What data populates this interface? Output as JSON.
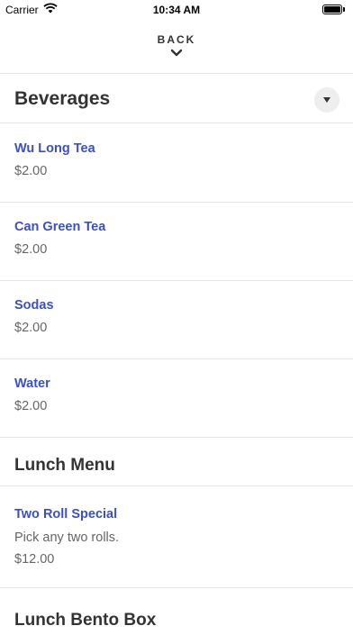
{
  "status_bar": {
    "carrier": "Carrier",
    "time": "10:34 AM",
    "battery_level": 1.0
  },
  "nav": {
    "back_label": "BACK",
    "back_icon": "chevron-down-icon"
  },
  "beverages": {
    "title": "Beverages",
    "toggle_icon": "caret-down-icon",
    "items": [
      {
        "name": "Wu Long Tea",
        "price": "$2.00"
      },
      {
        "name": "Can Green Tea",
        "price": "$2.00"
      },
      {
        "name": "Sodas",
        "price": "$2.00"
      },
      {
        "name": "Water",
        "price": "$2.00"
      }
    ]
  },
  "lunch_menu": {
    "title": "Lunch Menu",
    "items": [
      {
        "name": "Two Roll Special",
        "description": "Pick any two rolls.",
        "price": "$12.00"
      }
    ]
  },
  "lunch_bento_box": {
    "title": "Lunch Bento Box"
  },
  "colors": {
    "item_name": "#3a4fc9",
    "divider": "#e5e5e5",
    "price_text": "#666666"
  }
}
